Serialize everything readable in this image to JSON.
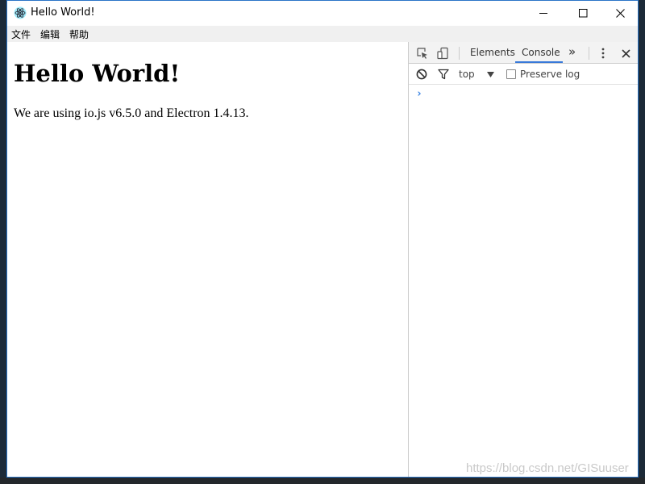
{
  "window": {
    "title": "Hello World!",
    "icon": "electron-atom-icon",
    "controls": [
      "minimize-icon",
      "maximize-icon",
      "close-icon"
    ]
  },
  "menubar": {
    "items": [
      "文件",
      "编辑",
      "帮助"
    ]
  },
  "page": {
    "heading": "Hello World!",
    "text": "We are using io.js v6.5.0 and Electron 1.4.13."
  },
  "devtools": {
    "tabs": [
      "Elements",
      "Console"
    ],
    "active_tab": "Console",
    "more_tabs_glyph": "»",
    "context": "top",
    "preserve_log_label": "Preserve log",
    "preserve_log_checked": false,
    "prompt_glyph": "›",
    "accent_color": "#3879d9"
  },
  "watermark": "https://blog.csdn.net/GISuuser"
}
